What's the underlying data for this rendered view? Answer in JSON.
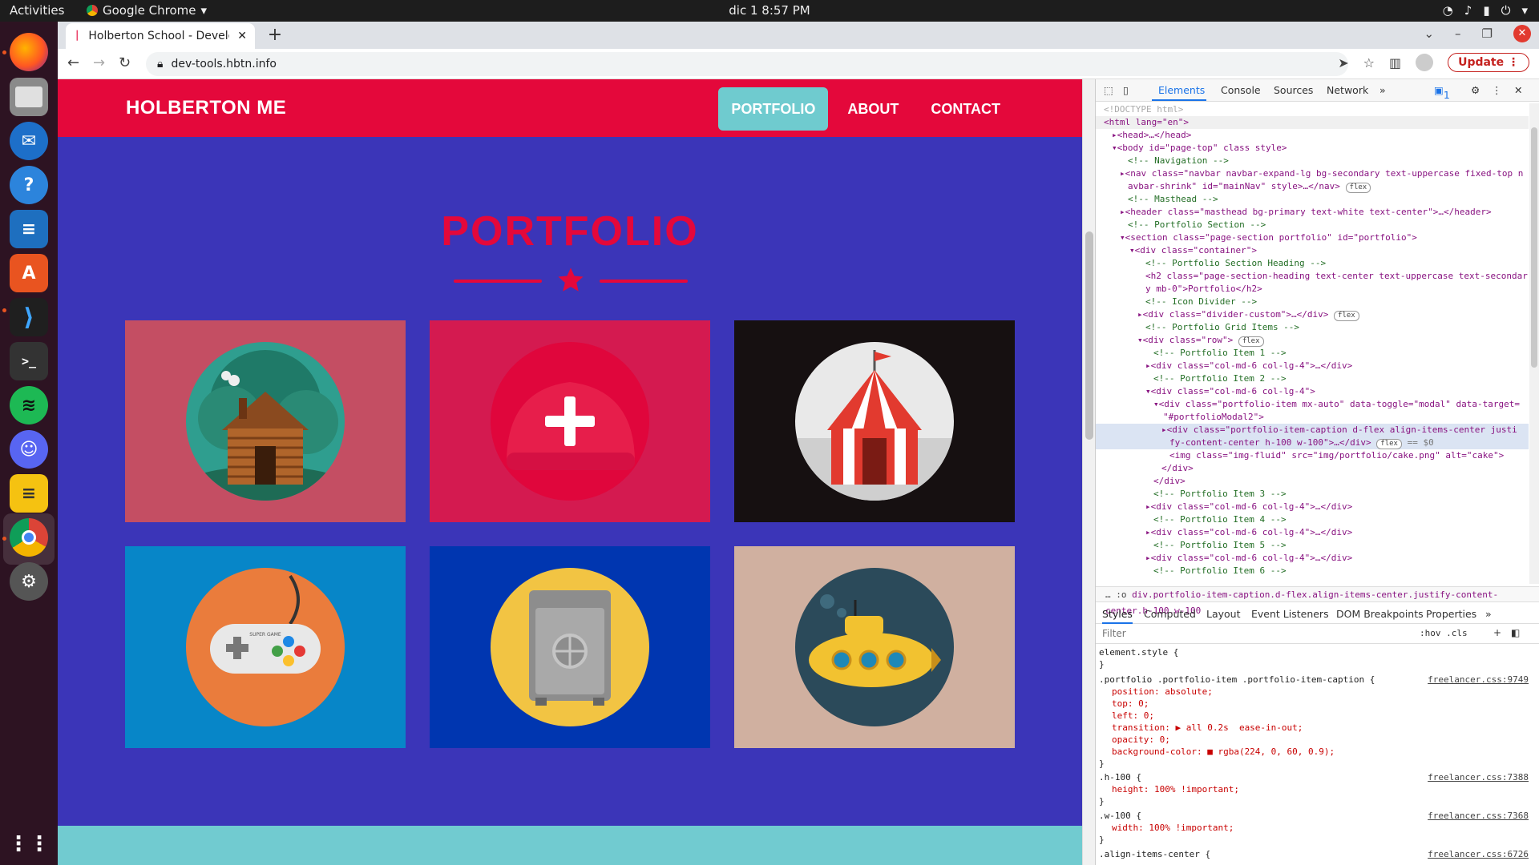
{
  "os": {
    "activities": "Activities",
    "app_name": "Google Chrome",
    "clock": "dic 1  8:57 PM"
  },
  "browser": {
    "tab_title": "Holberton School - Develo",
    "url": "dev-tools.hbtn.info",
    "update_label": "Update"
  },
  "site": {
    "brand": "HOLBERTON ME",
    "nav": [
      "PORTFOLIO",
      "ABOUT",
      "CONTACT"
    ],
    "section_title": "PORTFOLIO",
    "colors": {
      "primary": "#e4083b",
      "secondary": "#3b35b8",
      "accent": "#6fcbcf"
    },
    "portfolio_items": [
      {
        "icon": "cabin-icon",
        "bg": "#c44e63"
      },
      {
        "icon": "cake-icon",
        "bg": "#e4083b"
      },
      {
        "icon": "circus-tent-icon",
        "bg": "#161011"
      },
      {
        "icon": "game-controller-icon",
        "bg": "#0786c8"
      },
      {
        "icon": "safe-icon",
        "bg": "#0036b0"
      },
      {
        "icon": "submarine-icon",
        "bg": "#d0b0a0"
      }
    ],
    "controller_text": "SUPER GAME"
  },
  "devtools": {
    "tabs": [
      "Elements",
      "Console",
      "Sources",
      "Network"
    ],
    "issues_count": "1",
    "dom_lines": [
      "<!DOCTYPE html>",
      "<html lang=\"en\">",
      "<head>…</head>",
      "<body id=\"page-top\" class style>",
      "<!-- Navigation -->",
      "<nav class=\"navbar navbar-expand-lg bg-secondary text-uppercase fixed-top n",
      "avbar-shrink\" id=\"mainNav\" style>…</nav>",
      "<!-- Masthead -->",
      "<header class=\"masthead bg-primary text-white text-center\">…</header>",
      "<!-- Portfolio Section -->",
      "<section class=\"page-section portfolio\" id=\"portfolio\">",
      "<div class=\"container\">",
      "<!-- Portfolio Section Heading -->",
      "<h2 class=\"page-section-heading text-center text-uppercase text-secondar",
      "y mb-0\">Portfolio</h2>",
      "<!-- Icon Divider -->",
      "<div class=\"divider-custom\">…</div>",
      "<!-- Portfolio Grid Items -->",
      "<div class=\"row\">",
      "<!-- Portfolio Item 1 -->",
      "<div class=\"col-md-6 col-lg-4\">…</div>",
      "<!-- Portfolio Item 2 -->",
      "<div class=\"col-md-6 col-lg-4\">",
      "<div class=\"portfolio-item mx-auto\" data-toggle=\"modal\" data-target=",
      "\"#portfolioModal2\">",
      "<div class=\"portfolio-item-caption d-flex align-items-center justi",
      "fy-content-center h-100 w-100\">…</div>",
      "<img class=\"img-fluid\" src=\"img/portfolio/cake.png\" alt=\"cake\">",
      "</div>",
      "</div>",
      "<!-- Portfolio Item 3 -->",
      "<div class=\"col-md-6 col-lg-4\">…</div>",
      "<!-- Portfolio Item 4 -->",
      "<div class=\"col-md-6 col-lg-4\">…</div>",
      "<!-- Portfolio Item 5 -->",
      "<div class=\"col-md-6 col-lg-4\">…</div>",
      "<!-- Portfolio Item 6 -->"
    ],
    "selected_suffix": "== $0",
    "breadcrumb": "div.portfolio-item-caption.d-flex.align-items-center.justify-content-center.h-100.w-100",
    "styles_tabs": [
      "Styles",
      "Computed",
      "Layout",
      "Event Listeners",
      "DOM Breakpoints",
      "Properties"
    ],
    "filter_placeholder": "Filter",
    "filter_tools": ":hov  .cls",
    "rules": [
      {
        "selector": "element.style {",
        "source": "",
        "props": []
      },
      {
        "selector": ".portfolio .portfolio-item .portfolio-item-caption {",
        "source": "freelancer.css:9749",
        "props": [
          "position: absolute;",
          "top: 0;",
          "left: 0;",
          "transition: ▶ all 0.2s  ease-in-out;",
          "opacity: 0;",
          "background-color: ■ rgba(224, 0, 60, 0.9);"
        ]
      },
      {
        "selector": ".h-100 {",
        "source": "freelancer.css:7388",
        "props": [
          "height: 100% !important;"
        ]
      },
      {
        "selector": ".w-100 {",
        "source": "freelancer.css:7368",
        "props": [
          "width: 100% !important;"
        ]
      },
      {
        "selector": ".align-items-center {",
        "source": "freelancer.css:6726",
        "props": []
      }
    ]
  }
}
